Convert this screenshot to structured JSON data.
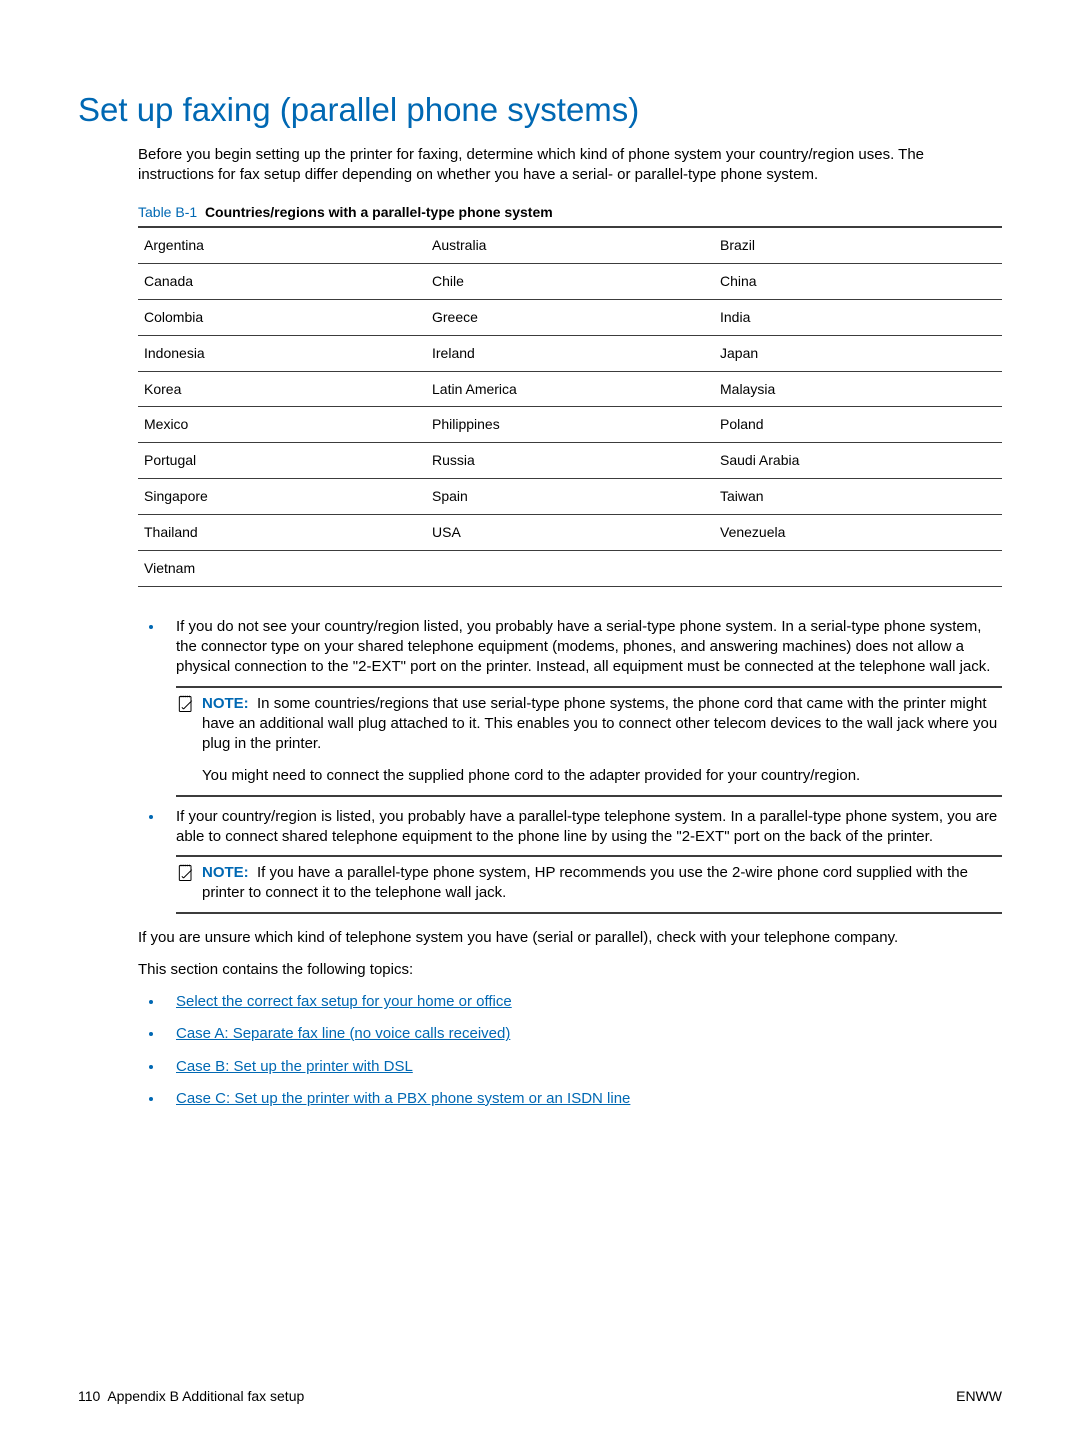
{
  "heading": "Set up faxing (parallel phone systems)",
  "intro": "Before you begin setting up the printer for faxing, determine which kind of phone system your country/region uses. The instructions for fax setup differ depending on whether you have a serial- or parallel-type phone system.",
  "table": {
    "label": "Table B-1",
    "title": "Countries/regions with a parallel-type phone system",
    "rows": [
      [
        "Argentina",
        "Australia",
        "Brazil"
      ],
      [
        "Canada",
        "Chile",
        "China"
      ],
      [
        "Colombia",
        "Greece",
        "India"
      ],
      [
        "Indonesia",
        "Ireland",
        "Japan"
      ],
      [
        "Korea",
        "Latin America",
        "Malaysia"
      ],
      [
        "Mexico",
        "Philippines",
        "Poland"
      ],
      [
        "Portugal",
        "Russia",
        "Saudi Arabia"
      ],
      [
        "Singapore",
        "Spain",
        "Taiwan"
      ],
      [
        "Thailand",
        "USA",
        "Venezuela"
      ],
      [
        "Vietnam",
        "",
        ""
      ]
    ]
  },
  "bullets": [
    {
      "text": "If you do not see your country/region listed, you probably have a serial-type phone system. In a serial-type phone system, the connector type on your shared telephone equipment (modems, phones, and answering machines) does not allow a physical connection to the \"2-EXT\" port on the printer. Instead, all equipment must be connected at the telephone wall jack.",
      "note": {
        "label": "NOTE:",
        "p1": "In some countries/regions that use serial-type phone systems, the phone cord that came with the printer might have an additional wall plug attached to it. This enables you to connect other telecom devices to the wall jack where you plug in the printer.",
        "p2": "You might need to connect the supplied phone cord to the adapter provided for your country/region."
      }
    },
    {
      "text": "If your country/region is listed, you probably have a parallel-type telephone system. In a parallel-type phone system, you are able to connect shared telephone equipment to the phone line by using the \"2-EXT\" port on the back of the printer.",
      "note": {
        "label": "NOTE:",
        "p1": "If you have a parallel-type phone system, HP recommends you use the 2-wire phone cord supplied with the printer to connect it to the telephone wall jack."
      }
    }
  ],
  "unsure": "If you are unsure which kind of telephone system you have (serial or parallel), check with your telephone company.",
  "topics_intro": "This section contains the following topics:",
  "topics": [
    "Select the correct fax setup for your home or office",
    "Case A: Separate fax line (no voice calls received)",
    "Case B: Set up the printer with DSL",
    "Case C: Set up the printer with a PBX phone system or an ISDN line"
  ],
  "footer": {
    "page": "110",
    "chapter": "Appendix B   Additional fax setup",
    "right": "ENWW"
  }
}
